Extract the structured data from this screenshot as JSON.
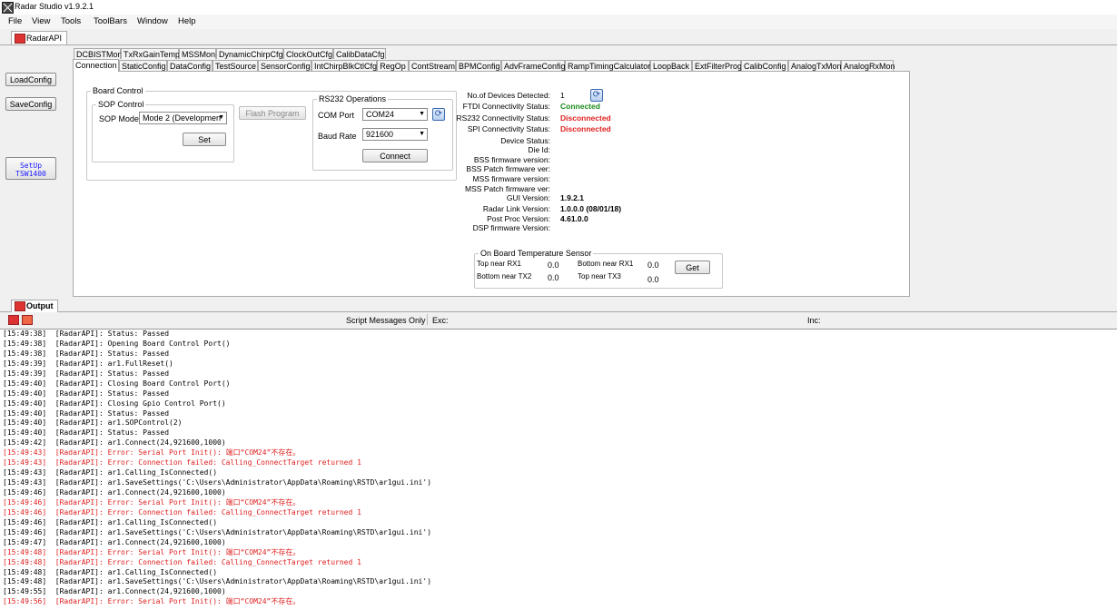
{
  "window": {
    "title": "Radar Studio v1.9.2.1"
  },
  "menu": [
    "File",
    "View",
    "Tools",
    "ToolBars",
    "Window",
    "Help"
  ],
  "top_tab": {
    "label": "RadarAPI"
  },
  "left_buttons": {
    "load": "LoadConfig",
    "save": "SaveConfig",
    "setup_line1": "SetUp",
    "setup_line2": "TSW1400"
  },
  "tabs_row1": [
    "DCBISTMon",
    "TxRxGainTemp",
    "MSSMon",
    "DynamicChirpCfg",
    "ClockOutCfg",
    "CalibDataCfg"
  ],
  "tabs_row2": [
    "Connection",
    "StaticConfig",
    "DataConfig",
    "TestSource",
    "SensorConfig",
    "IntChirpBlkCtlCfg",
    "RegOp",
    "ContStream",
    "BPMConfig",
    "AdvFrameConfig",
    "RampTimingCalculator",
    "LoopBack",
    "ExtFilterProg",
    "CalibConfig",
    "AnalogTxMon",
    "AnalogRxMon"
  ],
  "board_control": {
    "title": "Board Control",
    "sop_title": "SOP Control",
    "sop_mode_label": "SOP Mode",
    "sop_mode_value": "Mode 2 (Developmen",
    "set_button": "Set",
    "flash_button": "Flash Program"
  },
  "rs232": {
    "title": "RS232 Operations",
    "com_port_label": "COM Port",
    "com_port_value": "COM24",
    "baud_label": "Baud Rate",
    "baud_value": "921600",
    "connect_button": "Connect"
  },
  "info": [
    {
      "label": "No.of Devices Detected:",
      "value": "1",
      "style": ""
    },
    {
      "label": "FTDI Connectivity Status:",
      "value": "Connected",
      "style": "green"
    },
    {
      "label": "RS232 Connectivity Status:",
      "value": "Disconnected",
      "style": "red"
    },
    {
      "label": "SPI Connectivity Status:",
      "value": "Disconnected",
      "style": "red"
    },
    {
      "label": "Device Status:",
      "value": "",
      "style": ""
    },
    {
      "label": "Die Id:",
      "value": "",
      "style": ""
    },
    {
      "label": "BSS firmware version:",
      "value": "",
      "style": ""
    },
    {
      "label": "BSS Patch firmware ver:",
      "value": "",
      "style": ""
    },
    {
      "label": "MSS firmware version:",
      "value": "",
      "style": ""
    },
    {
      "label": "MSS Patch firmware ver:",
      "value": "",
      "style": ""
    },
    {
      "label": "GUI Version:",
      "value": "1.9.2.1",
      "style": "bold"
    },
    {
      "label": "Radar Link Version:",
      "value": "1.0.0.0 (08/01/18)",
      "style": "bold"
    },
    {
      "label": "Post Proc Version:",
      "value": "4.61.0.0",
      "style": "bold"
    },
    {
      "label": "DSP firmware Version:",
      "value": "",
      "style": ""
    }
  ],
  "temperature": {
    "title": "On Board Temperature Sensor",
    "top_rx1_label": "Top near RX1",
    "top_rx1_value": "0.0",
    "bottom_rx1_label": "Bottom near RX1",
    "bottom_rx1_value": "0.0",
    "bottom_tx2_label": "Bottom near TX2",
    "bottom_tx2_value": "0.0",
    "top_tx3_label": "Top near TX3",
    "top_tx3_value": "0.0",
    "get_button": "Get"
  },
  "output": {
    "tab_label": "Output",
    "script_messages": "Script Messages Only",
    "exc_label": "Exc:",
    "inc_label": "Inc:",
    "lines": [
      {
        "t": "[15:49:38]  [RadarAPI]: Status: Passed",
        "err": false
      },
      {
        "t": "[15:49:38]  [RadarAPI]: Opening Board Control Port()",
        "err": false
      },
      {
        "t": "[15:49:38]  [RadarAPI]: Status: Passed",
        "err": false
      },
      {
        "t": "[15:49:39]  [RadarAPI]: ar1.FullReset()",
        "err": false
      },
      {
        "t": "[15:49:39]  [RadarAPI]: Status: Passed",
        "err": false
      },
      {
        "t": "[15:49:40]  [RadarAPI]: Closing Board Control Port()",
        "err": false
      },
      {
        "t": "[15:49:40]  [RadarAPI]: Status: Passed",
        "err": false
      },
      {
        "t": "[15:49:40]  [RadarAPI]: Closing Gpio Control Port()",
        "err": false
      },
      {
        "t": "[15:49:40]  [RadarAPI]: Status: Passed",
        "err": false
      },
      {
        "t": "[15:49:40]  [RadarAPI]: ar1.SOPControl(2)",
        "err": false
      },
      {
        "t": "[15:49:40]  [RadarAPI]: Status: Passed",
        "err": false
      },
      {
        "t": "[15:49:42]  [RadarAPI]: ar1.Connect(24,921600,1000)",
        "err": false
      },
      {
        "t": "[15:49:43]  [RadarAPI]: Error: Serial Port Init(): 端口“COM24”不存在。",
        "err": true
      },
      {
        "t": "[15:49:43]  [RadarAPI]: Error: Connection failed: Calling_ConnectTarget returned 1",
        "err": true
      },
      {
        "t": "[15:49:43]  [RadarAPI]: ar1.Calling_IsConnected()",
        "err": false
      },
      {
        "t": "[15:49:43]  [RadarAPI]: ar1.SaveSettings('C:\\Users\\Administrator\\AppData\\Roaming\\RSTD\\ar1gui.ini')",
        "err": false
      },
      {
        "t": "[15:49:46]  [RadarAPI]: ar1.Connect(24,921600,1000)",
        "err": false
      },
      {
        "t": "[15:49:46]  [RadarAPI]: Error: Serial Port Init(): 端口“COM24”不存在。",
        "err": true
      },
      {
        "t": "[15:49:46]  [RadarAPI]: Error: Connection failed: Calling_ConnectTarget returned 1",
        "err": true
      },
      {
        "t": "[15:49:46]  [RadarAPI]: ar1.Calling_IsConnected()",
        "err": false
      },
      {
        "t": "[15:49:46]  [RadarAPI]: ar1.SaveSettings('C:\\Users\\Administrator\\AppData\\Roaming\\RSTD\\ar1gui.ini')",
        "err": false
      },
      {
        "t": "[15:49:47]  [RadarAPI]: ar1.Connect(24,921600,1000)",
        "err": false
      },
      {
        "t": "[15:49:48]  [RadarAPI]: Error: Serial Port Init(): 端口“COM24”不存在。",
        "err": true
      },
      {
        "t": "[15:49:48]  [RadarAPI]: Error: Connection failed: Calling_ConnectTarget returned 1",
        "err": true
      },
      {
        "t": "[15:49:48]  [RadarAPI]: ar1.Calling_IsConnected()",
        "err": false
      },
      {
        "t": "[15:49:48]  [RadarAPI]: ar1.SaveSettings('C:\\Users\\Administrator\\AppData\\Roaming\\RSTD\\ar1gui.ini')",
        "err": false
      },
      {
        "t": "[15:49:55]  [RadarAPI]: ar1.Connect(24,921600,1000)",
        "err": false
      },
      {
        "t": "[15:49:56]  [RadarAPI]: Error: Serial Port Init(): 端口“COM24”不存在。",
        "err": true
      }
    ]
  }
}
